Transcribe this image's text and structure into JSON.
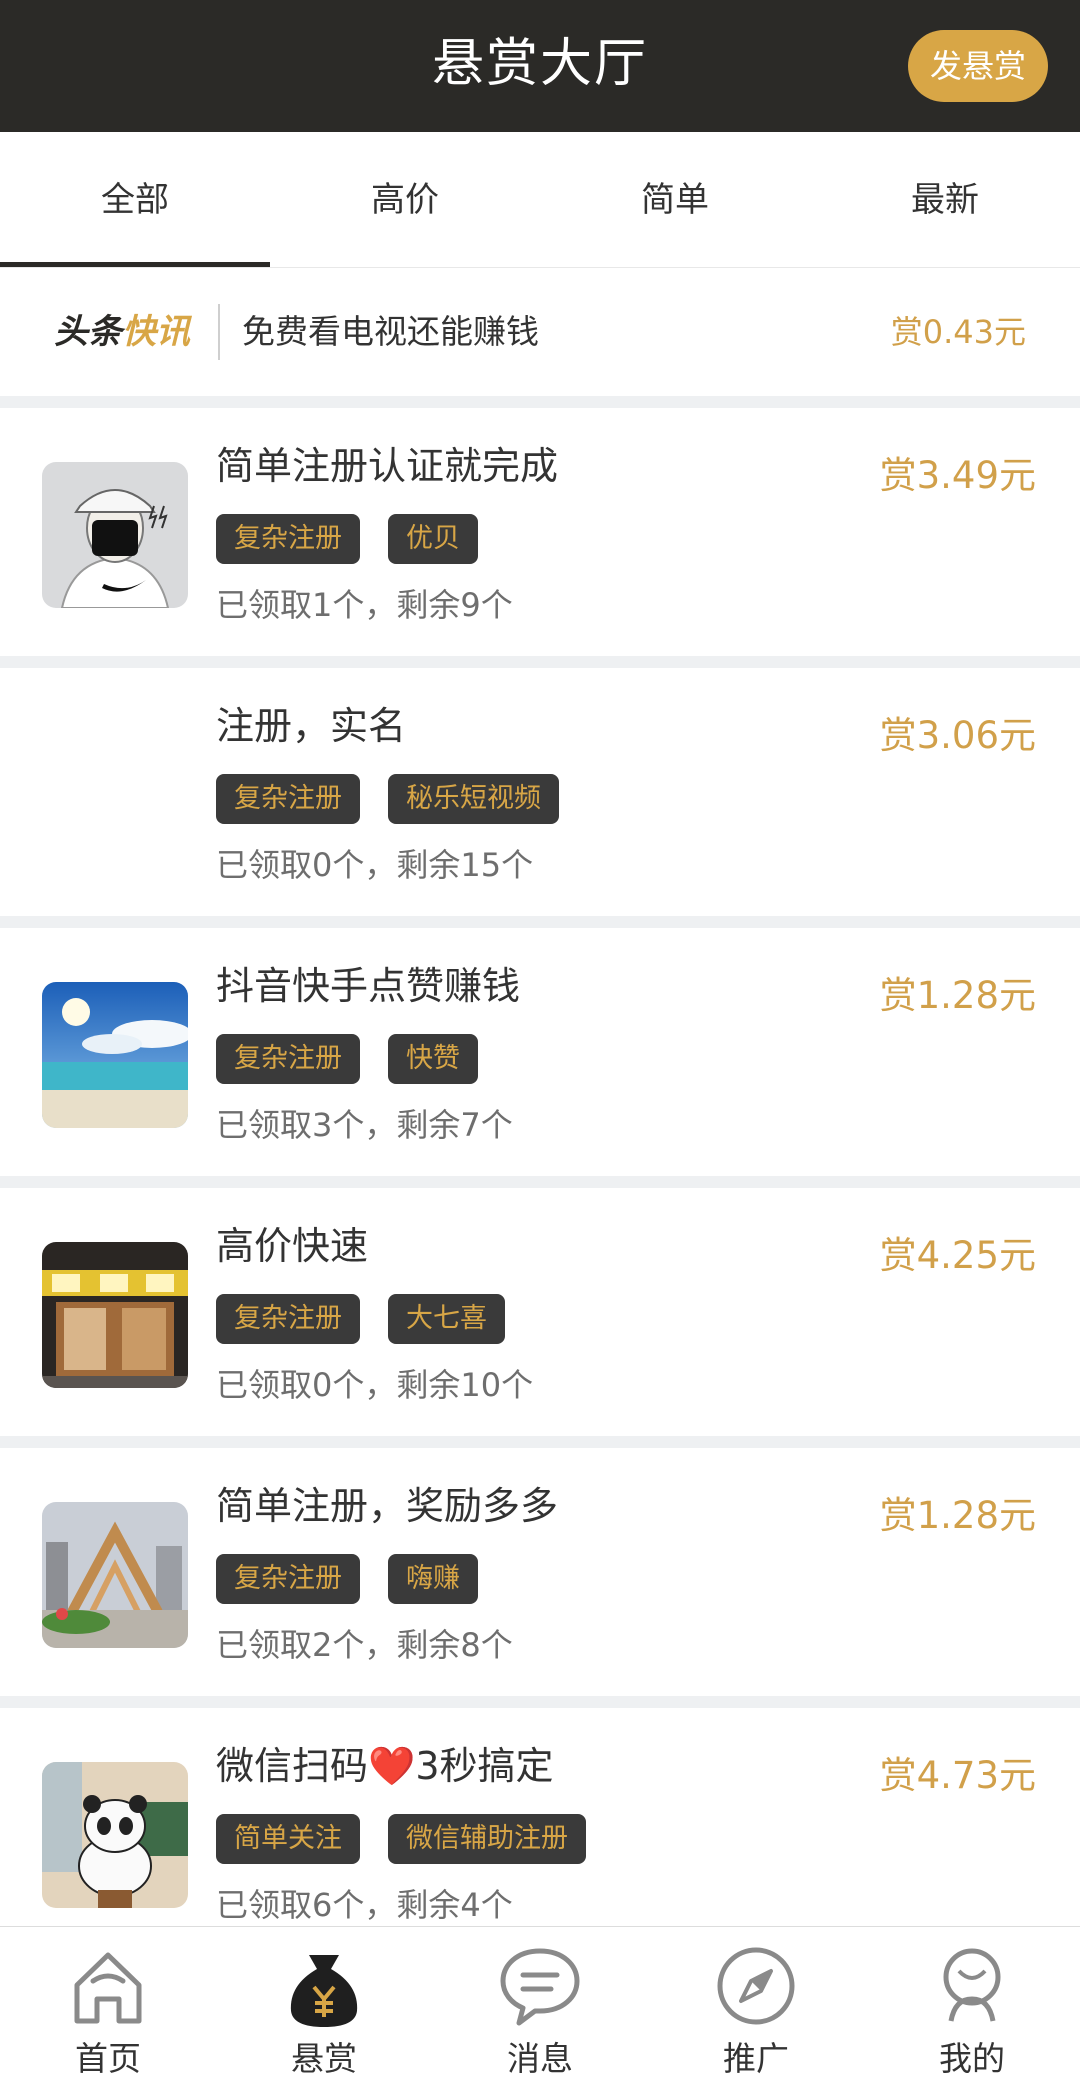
{
  "header": {
    "title": "悬赏大厅",
    "post_button": "发悬赏"
  },
  "tabs": [
    {
      "label": "全部"
    },
    {
      "label": "高价"
    },
    {
      "label": "简单"
    },
    {
      "label": "最新"
    }
  ],
  "ticker": {
    "logo_a": "头条",
    "logo_b": "快讯",
    "text": "免费看电视还能赚钱",
    "reward": "赏0.43元"
  },
  "tasks": [
    {
      "title": "简单注册认证就完成",
      "reward": "赏3.49元",
      "tags": [
        "复杂注册",
        "优贝"
      ],
      "meta": "已领取1个，剩余9个",
      "thumb": "avatar-cap"
    },
    {
      "title": "注册，实名",
      "reward": "赏3.06元",
      "tags": [
        "复杂注册",
        "秘乐短视频"
      ],
      "meta": "已领取0个，剩余15个",
      "thumb": ""
    },
    {
      "title": "抖音快手点赞赚钱",
      "reward": "赏1.28元",
      "tags": [
        "复杂注册",
        "快赞"
      ],
      "meta": "已领取3个，剩余7个",
      "thumb": "beach"
    },
    {
      "title": "高价快速",
      "reward": "赏4.25元",
      "tags": [
        "复杂注册",
        "大七喜"
      ],
      "meta": "已领取0个，剩余10个",
      "thumb": "shopfront"
    },
    {
      "title": "简单注册，奖励多多",
      "reward": "赏1.28元",
      "tags": [
        "复杂注册",
        "嗨赚"
      ],
      "meta": "已领取2个，剩余8个",
      "thumb": "plaza"
    },
    {
      "title": "微信扫码❤️3秒搞定",
      "reward": "赏4.73元",
      "tags": [
        "简单关注",
        "微信辅助注册"
      ],
      "meta": "已领取6个，剩余4个",
      "thumb": "panda"
    }
  ],
  "nav": [
    {
      "label": "首页",
      "icon": "home-icon"
    },
    {
      "label": "悬赏",
      "icon": "money-bag-icon"
    },
    {
      "label": "消息",
      "icon": "message-icon"
    },
    {
      "label": "推广",
      "icon": "compass-icon"
    },
    {
      "label": "我的",
      "icon": "user-icon"
    }
  ],
  "colors": {
    "header_bg": "#2b2a27",
    "accent": "#d8a646",
    "reward": "#d1a04a"
  }
}
